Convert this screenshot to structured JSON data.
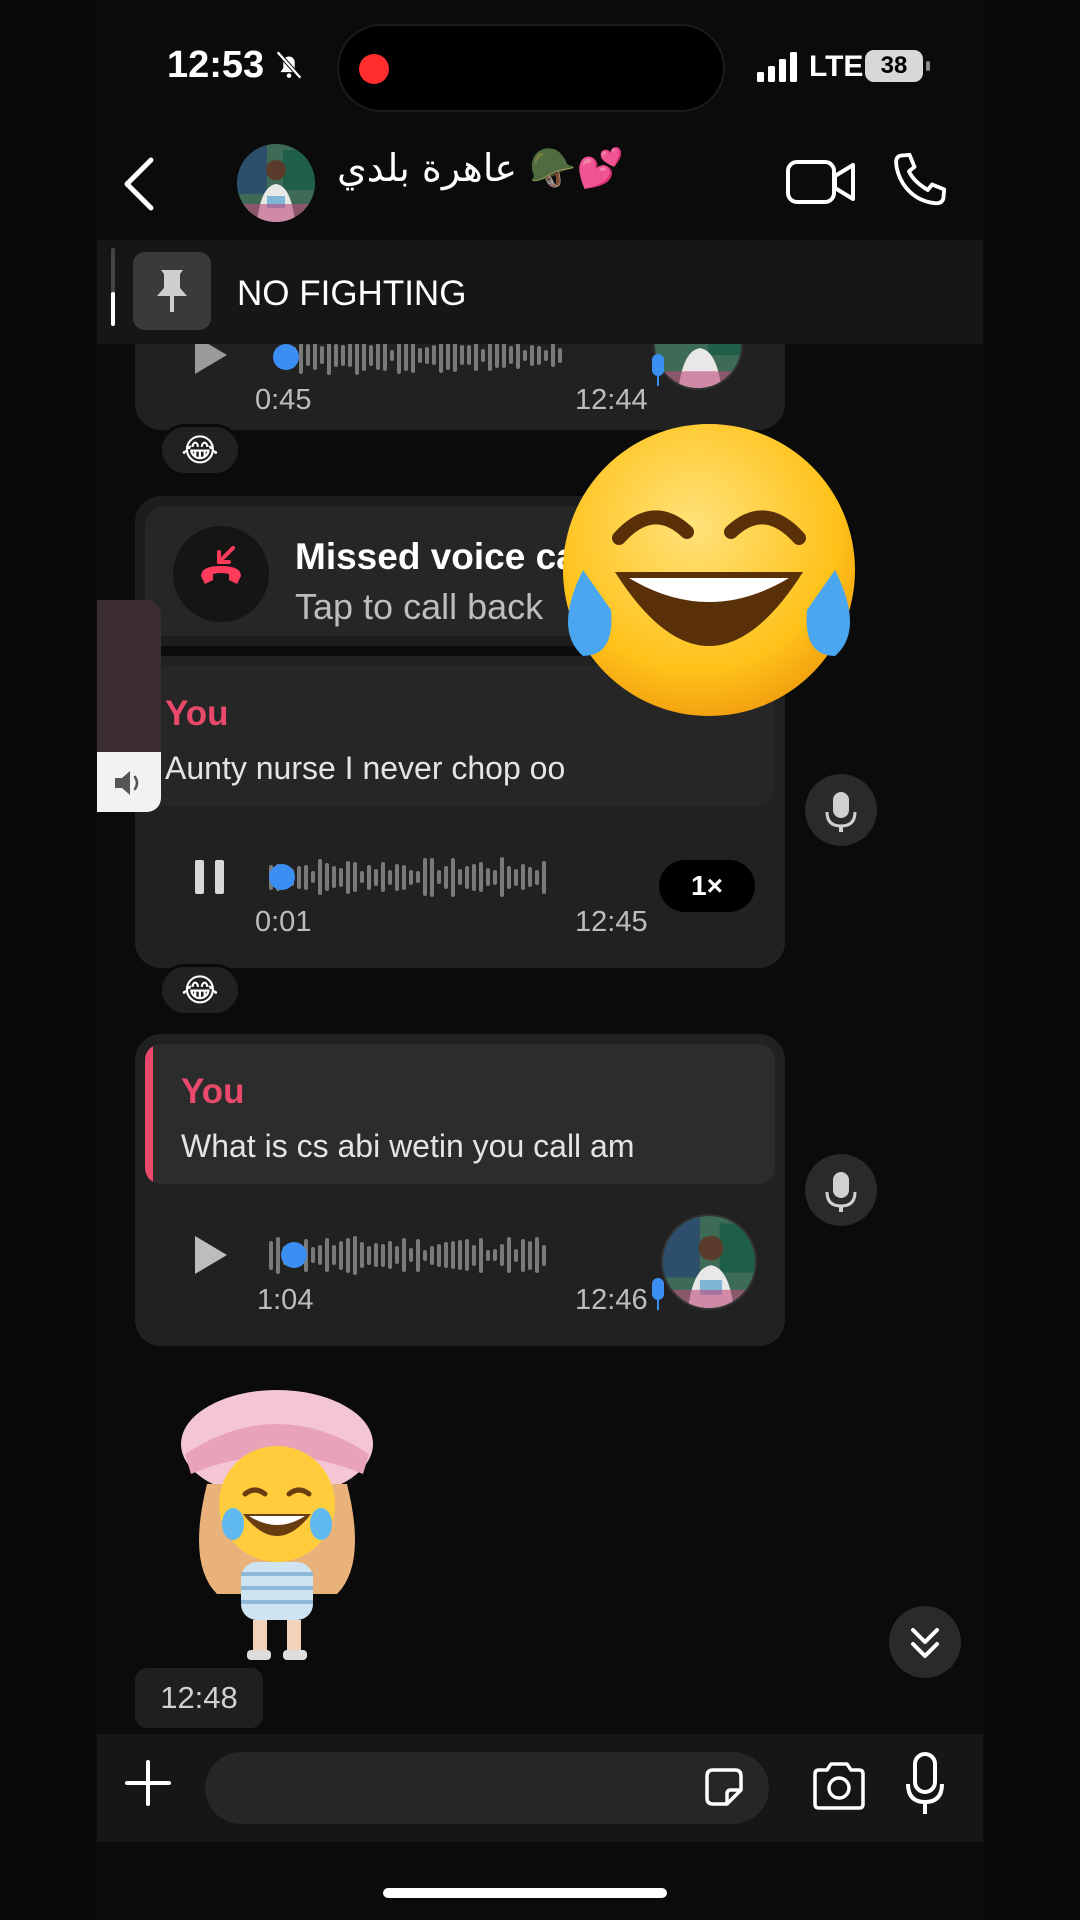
{
  "status_bar": {
    "time": "12:53",
    "network": "LTE",
    "battery": "38"
  },
  "header": {
    "title": "عاهرة بلدي 🪖💕",
    "back_icon": "chevron-left-icon",
    "video_icon": "video-camera-icon",
    "call_icon": "phone-icon"
  },
  "pinned": {
    "text": "NO FIGHTING",
    "icon": "pin-icon"
  },
  "messages": {
    "voice1": {
      "duration": "0:45",
      "time": "12:44",
      "reaction": "😂"
    },
    "missed_call": {
      "title": "Missed voice call",
      "subtitle": "Tap to call back"
    },
    "voice2": {
      "reply_author": "You",
      "reply_text": "Aunty nurse I never chop oo",
      "duration": "0:01",
      "time": "12:45",
      "speed": "1×",
      "reaction": "😂",
      "progress": 0.04
    },
    "voice3": {
      "reply_author": "You",
      "reply_text": "What is cs abi wetin you call am",
      "duration": "1:04",
      "time": "12:46",
      "progress": 0.06
    },
    "sticker_time": "12:48"
  },
  "overlay_emoji": "😂",
  "composer": {
    "placeholder": ""
  },
  "colors": {
    "accent_pink": "#e94a6b",
    "seek_blue": "#3b8ff2",
    "missed_red": "#ff3b5c"
  }
}
